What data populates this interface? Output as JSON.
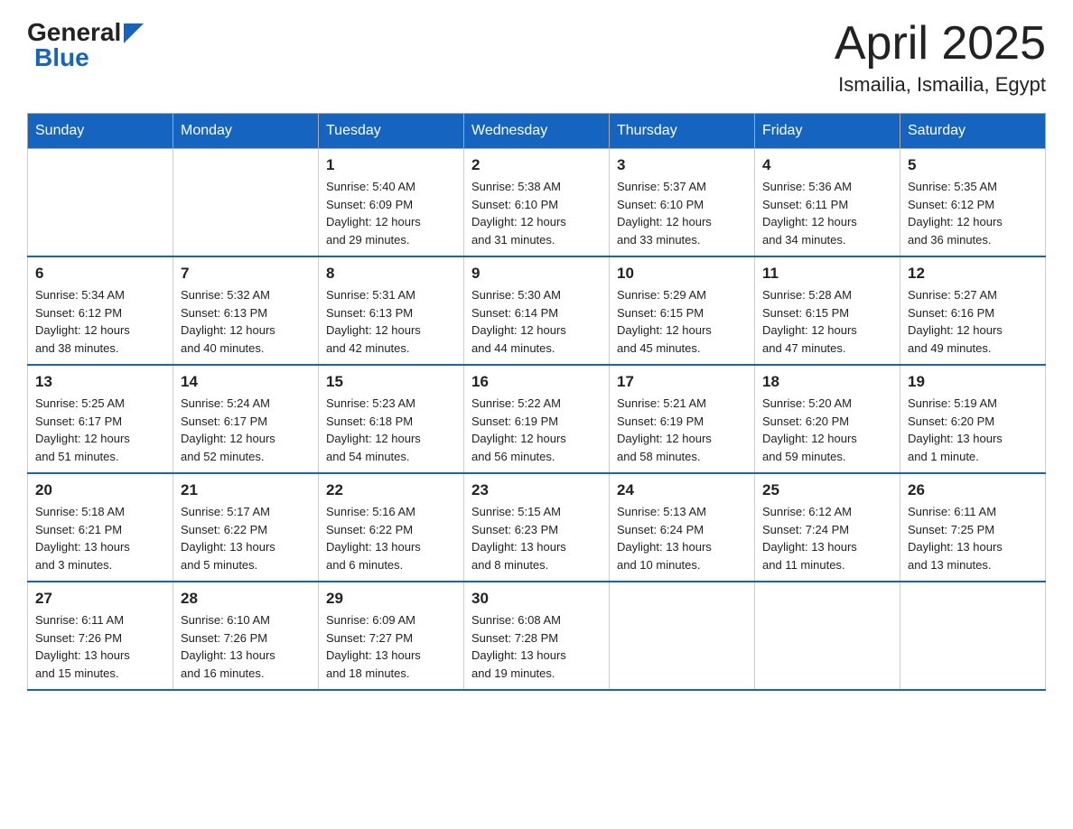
{
  "header": {
    "logo_general": "General",
    "logo_blue": "Blue",
    "title": "April 2025",
    "subtitle": "Ismailia, Ismailia, Egypt"
  },
  "days_of_week": [
    "Sunday",
    "Monday",
    "Tuesday",
    "Wednesday",
    "Thursday",
    "Friday",
    "Saturday"
  ],
  "weeks": [
    [
      {
        "day": "",
        "detail": ""
      },
      {
        "day": "",
        "detail": ""
      },
      {
        "day": "1",
        "detail": "Sunrise: 5:40 AM\nSunset: 6:09 PM\nDaylight: 12 hours\nand 29 minutes."
      },
      {
        "day": "2",
        "detail": "Sunrise: 5:38 AM\nSunset: 6:10 PM\nDaylight: 12 hours\nand 31 minutes."
      },
      {
        "day": "3",
        "detail": "Sunrise: 5:37 AM\nSunset: 6:10 PM\nDaylight: 12 hours\nand 33 minutes."
      },
      {
        "day": "4",
        "detail": "Sunrise: 5:36 AM\nSunset: 6:11 PM\nDaylight: 12 hours\nand 34 minutes."
      },
      {
        "day": "5",
        "detail": "Sunrise: 5:35 AM\nSunset: 6:12 PM\nDaylight: 12 hours\nand 36 minutes."
      }
    ],
    [
      {
        "day": "6",
        "detail": "Sunrise: 5:34 AM\nSunset: 6:12 PM\nDaylight: 12 hours\nand 38 minutes."
      },
      {
        "day": "7",
        "detail": "Sunrise: 5:32 AM\nSunset: 6:13 PM\nDaylight: 12 hours\nand 40 minutes."
      },
      {
        "day": "8",
        "detail": "Sunrise: 5:31 AM\nSunset: 6:13 PM\nDaylight: 12 hours\nand 42 minutes."
      },
      {
        "day": "9",
        "detail": "Sunrise: 5:30 AM\nSunset: 6:14 PM\nDaylight: 12 hours\nand 44 minutes."
      },
      {
        "day": "10",
        "detail": "Sunrise: 5:29 AM\nSunset: 6:15 PM\nDaylight: 12 hours\nand 45 minutes."
      },
      {
        "day": "11",
        "detail": "Sunrise: 5:28 AM\nSunset: 6:15 PM\nDaylight: 12 hours\nand 47 minutes."
      },
      {
        "day": "12",
        "detail": "Sunrise: 5:27 AM\nSunset: 6:16 PM\nDaylight: 12 hours\nand 49 minutes."
      }
    ],
    [
      {
        "day": "13",
        "detail": "Sunrise: 5:25 AM\nSunset: 6:17 PM\nDaylight: 12 hours\nand 51 minutes."
      },
      {
        "day": "14",
        "detail": "Sunrise: 5:24 AM\nSunset: 6:17 PM\nDaylight: 12 hours\nand 52 minutes."
      },
      {
        "day": "15",
        "detail": "Sunrise: 5:23 AM\nSunset: 6:18 PM\nDaylight: 12 hours\nand 54 minutes."
      },
      {
        "day": "16",
        "detail": "Sunrise: 5:22 AM\nSunset: 6:19 PM\nDaylight: 12 hours\nand 56 minutes."
      },
      {
        "day": "17",
        "detail": "Sunrise: 5:21 AM\nSunset: 6:19 PM\nDaylight: 12 hours\nand 58 minutes."
      },
      {
        "day": "18",
        "detail": "Sunrise: 5:20 AM\nSunset: 6:20 PM\nDaylight: 12 hours\nand 59 minutes."
      },
      {
        "day": "19",
        "detail": "Sunrise: 5:19 AM\nSunset: 6:20 PM\nDaylight: 13 hours\nand 1 minute."
      }
    ],
    [
      {
        "day": "20",
        "detail": "Sunrise: 5:18 AM\nSunset: 6:21 PM\nDaylight: 13 hours\nand 3 minutes."
      },
      {
        "day": "21",
        "detail": "Sunrise: 5:17 AM\nSunset: 6:22 PM\nDaylight: 13 hours\nand 5 minutes."
      },
      {
        "day": "22",
        "detail": "Sunrise: 5:16 AM\nSunset: 6:22 PM\nDaylight: 13 hours\nand 6 minutes."
      },
      {
        "day": "23",
        "detail": "Sunrise: 5:15 AM\nSunset: 6:23 PM\nDaylight: 13 hours\nand 8 minutes."
      },
      {
        "day": "24",
        "detail": "Sunrise: 5:13 AM\nSunset: 6:24 PM\nDaylight: 13 hours\nand 10 minutes."
      },
      {
        "day": "25",
        "detail": "Sunrise: 6:12 AM\nSunset: 7:24 PM\nDaylight: 13 hours\nand 11 minutes."
      },
      {
        "day": "26",
        "detail": "Sunrise: 6:11 AM\nSunset: 7:25 PM\nDaylight: 13 hours\nand 13 minutes."
      }
    ],
    [
      {
        "day": "27",
        "detail": "Sunrise: 6:11 AM\nSunset: 7:26 PM\nDaylight: 13 hours\nand 15 minutes."
      },
      {
        "day": "28",
        "detail": "Sunrise: 6:10 AM\nSunset: 7:26 PM\nDaylight: 13 hours\nand 16 minutes."
      },
      {
        "day": "29",
        "detail": "Sunrise: 6:09 AM\nSunset: 7:27 PM\nDaylight: 13 hours\nand 18 minutes."
      },
      {
        "day": "30",
        "detail": "Sunrise: 6:08 AM\nSunset: 7:28 PM\nDaylight: 13 hours\nand 19 minutes."
      },
      {
        "day": "",
        "detail": ""
      },
      {
        "day": "",
        "detail": ""
      },
      {
        "day": "",
        "detail": ""
      }
    ]
  ]
}
